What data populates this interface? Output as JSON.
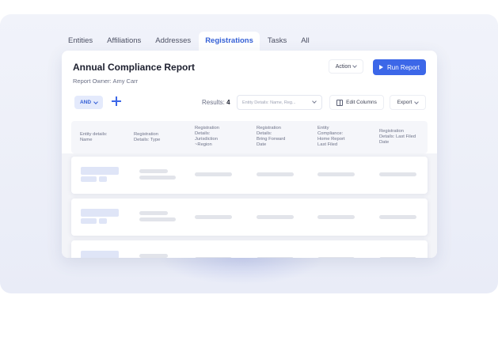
{
  "tabs": [
    {
      "label": "Entities",
      "active": false
    },
    {
      "label": "Affiliations",
      "active": false
    },
    {
      "label": "Addresses",
      "active": false
    },
    {
      "label": "Registrations",
      "active": true
    },
    {
      "label": "Tasks",
      "active": false
    },
    {
      "label": "All",
      "active": false
    }
  ],
  "report": {
    "title": "Annual Compliance Report",
    "owner": "Report Owner: Amy Carr"
  },
  "toolbar": {
    "action_label": "Action",
    "run_label": "Run Report",
    "and_label": "AND",
    "results_label": "Results:",
    "results_count": "4",
    "filter_placeholder": "Entity Details: Name, Reg...",
    "edit_columns_label": "Edit Columns",
    "export_label": "Export"
  },
  "table": {
    "columns": [
      "Entity details:\nName",
      "Registration\nDetails: Type",
      "Registration\nDetails:\nJurisdiction\n~Region",
      "Registration\nDetails:\nBring Forward\nDate",
      "Entity\nCompliance:\nHome Report\nLast Filed",
      "Registration\nDetails: Last Filed\nDate"
    ],
    "row_count_visible": 3
  },
  "colors": {
    "accent": "#3c67e8",
    "active_tab": "#3560d6",
    "backdrop": "#eef0f8",
    "skeleton": "#e2e4ea",
    "skeleton_blue": "#dfe5f7"
  },
  "icons": [
    "play-icon",
    "chevron-down-icon",
    "plus-icon",
    "columns-icon"
  ]
}
